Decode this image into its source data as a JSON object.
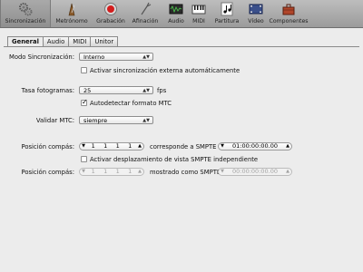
{
  "toolbar": {
    "items": [
      {
        "label": "Sincronización",
        "icon": "gears-icon"
      },
      {
        "label": "Metrónomo",
        "icon": "metronome-icon"
      },
      {
        "label": "Grabación",
        "icon": "record-icon"
      },
      {
        "label": "Afinación",
        "icon": "tuning-fork-icon"
      },
      {
        "label": "Audio",
        "icon": "audio-icon"
      },
      {
        "label": "MIDI",
        "icon": "midi-icon"
      },
      {
        "label": "Partitura",
        "icon": "score-icon"
      },
      {
        "label": "Vídeo",
        "icon": "video-icon"
      },
      {
        "label": "Componentes",
        "icon": "toolbox-icon"
      }
    ]
  },
  "tabs": [
    "General",
    "Audio",
    "MIDI",
    "Unitor"
  ],
  "general": {
    "sync_mode_label": "Modo Sincronización:",
    "sync_mode_value": "Interno",
    "auto_sync_label": "Activar sincronización externa automáticamente",
    "frame_rate_label": "Tasa fotogramas:",
    "frame_rate_value": "25",
    "fps_label": "fps",
    "auto_mtc_label": "Autodetectar formato MTC",
    "valid_mtc_label": "Validar MTC:",
    "valid_mtc_value": "siempre",
    "bar_pos_label": "Posición compás:",
    "bar_pos_values": [
      "1",
      "1",
      "1",
      "1"
    ],
    "corresponds_label": "corresponde a SMPTE",
    "smpte_value": "01:00:00:00.00",
    "smpte_view_label": "Activar desplazamiento de vista SMPTE independiente",
    "bar_pos2_label": "Posición compás:",
    "bar_pos2_values": [
      "1",
      "1",
      "1",
      "1"
    ],
    "shown_as_label": "mostrado como SMPTE",
    "smpte2_value": "00:00:00:00.00"
  },
  "colors": {
    "toolbar_top": "#bdbdbd",
    "toolbar_bottom": "#9b9b9b",
    "background": "#ececec"
  }
}
